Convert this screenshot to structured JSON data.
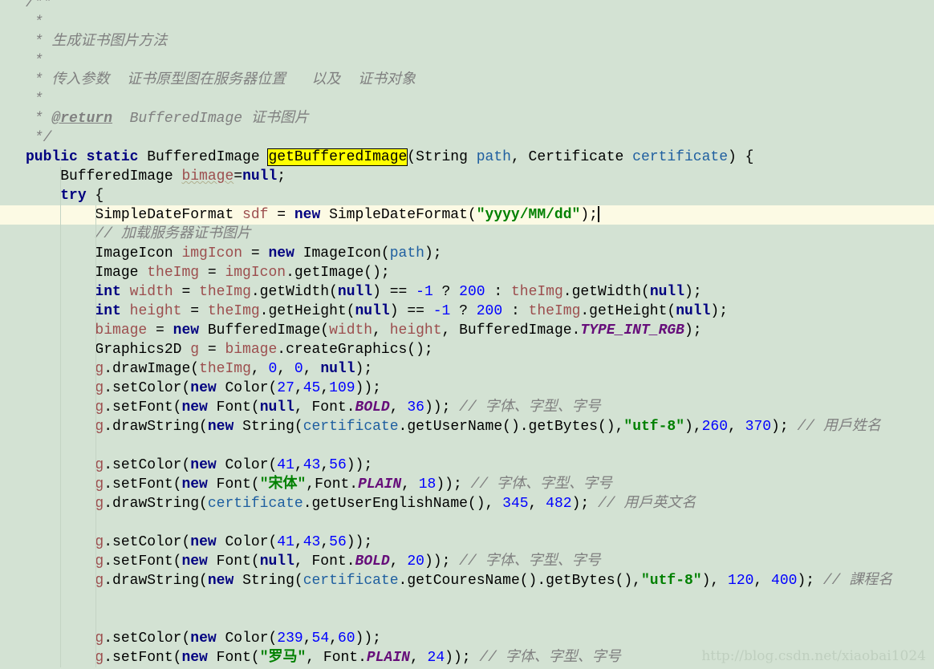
{
  "editor": {
    "current_line": 11,
    "lines": [
      [
        [
          "c",
          "/**"
        ]
      ],
      [
        [
          "c",
          " *"
        ]
      ],
      [
        [
          "c",
          " * 生成证书图片方法"
        ]
      ],
      [
        [
          "c",
          " *"
        ]
      ],
      [
        [
          "c",
          " * 传入参数  证书原型图在服务器位置   以及  证书对象"
        ]
      ],
      [
        [
          "c",
          " *"
        ]
      ],
      [
        [
          "c",
          " * "
        ],
        [
          "ct",
          "@return"
        ],
        [
          "c",
          "  BufferedImage 证书图片"
        ]
      ],
      [
        [
          "c",
          " */"
        ]
      ],
      [
        [
          "k",
          "public static "
        ],
        [
          "t",
          "BufferedImage "
        ],
        [
          "hl",
          "getBufferedImage"
        ],
        [
          "t",
          "(String "
        ],
        [
          "p",
          "path"
        ],
        [
          "t",
          ", Certificate "
        ],
        [
          "p",
          "certificate"
        ],
        [
          "t",
          ") {"
        ]
      ],
      [
        [
          "t",
          "    BufferedImage "
        ],
        [
          "vw",
          "bimage"
        ],
        [
          "t",
          "="
        ],
        [
          "k",
          "null"
        ],
        [
          "t",
          ";"
        ]
      ],
      [
        [
          "t",
          "    "
        ],
        [
          "k",
          "try"
        ],
        [
          "t",
          " {"
        ]
      ],
      [
        [
          "t",
          "        SimpleDateFormat "
        ],
        [
          "v",
          "sdf"
        ],
        [
          "t",
          " = "
        ],
        [
          "k",
          "new "
        ],
        [
          "t",
          "SimpleDateFormat("
        ],
        [
          "s",
          "\"yyyy/MM/dd\""
        ],
        [
          "t",
          ");"
        ],
        [
          "caret",
          ""
        ]
      ],
      [
        [
          "c",
          "        // 加载服务器证书图片"
        ]
      ],
      [
        [
          "t",
          "        ImageIcon "
        ],
        [
          "v",
          "imgIcon"
        ],
        [
          "t",
          " = "
        ],
        [
          "k",
          "new "
        ],
        [
          "t",
          "ImageIcon("
        ],
        [
          "p",
          "path"
        ],
        [
          "t",
          ");"
        ]
      ],
      [
        [
          "t",
          "        Image "
        ],
        [
          "v",
          "theImg"
        ],
        [
          "t",
          " = "
        ],
        [
          "v",
          "imgIcon"
        ],
        [
          "t",
          ".getImage();"
        ]
      ],
      [
        [
          "t",
          "        "
        ],
        [
          "k",
          "int "
        ],
        [
          "v",
          "width"
        ],
        [
          "t",
          " = "
        ],
        [
          "v",
          "theImg"
        ],
        [
          "t",
          ".getWidth("
        ],
        [
          "k",
          "null"
        ],
        [
          "t",
          ") == "
        ],
        [
          "n",
          "-1"
        ],
        [
          "t",
          " ? "
        ],
        [
          "n",
          "200"
        ],
        [
          "t",
          " : "
        ],
        [
          "v",
          "theImg"
        ],
        [
          "t",
          ".getWidth("
        ],
        [
          "k",
          "null"
        ],
        [
          "t",
          ");"
        ]
      ],
      [
        [
          "t",
          "        "
        ],
        [
          "k",
          "int "
        ],
        [
          "v",
          "height"
        ],
        [
          "t",
          " = "
        ],
        [
          "v",
          "theImg"
        ],
        [
          "t",
          ".getHeight("
        ],
        [
          "k",
          "null"
        ],
        [
          "t",
          ") == "
        ],
        [
          "n",
          "-1"
        ],
        [
          "t",
          " ? "
        ],
        [
          "n",
          "200"
        ],
        [
          "t",
          " : "
        ],
        [
          "v",
          "theImg"
        ],
        [
          "t",
          ".getHeight("
        ],
        [
          "k",
          "null"
        ],
        [
          "t",
          ");"
        ]
      ],
      [
        [
          "t",
          "        "
        ],
        [
          "v",
          "bimage"
        ],
        [
          "t",
          " = "
        ],
        [
          "k",
          "new "
        ],
        [
          "t",
          "BufferedImage("
        ],
        [
          "v",
          "width"
        ],
        [
          "t",
          ", "
        ],
        [
          "v",
          "height"
        ],
        [
          "t",
          ", BufferedImage."
        ],
        [
          "f",
          "TYPE_INT_RGB"
        ],
        [
          "t",
          ");"
        ]
      ],
      [
        [
          "t",
          "        Graphics2D "
        ],
        [
          "v",
          "g"
        ],
        [
          "t",
          " = "
        ],
        [
          "v",
          "bimage"
        ],
        [
          "t",
          ".createGraphics();"
        ]
      ],
      [
        [
          "t",
          "        "
        ],
        [
          "v",
          "g"
        ],
        [
          "t",
          ".drawImage("
        ],
        [
          "v",
          "theImg"
        ],
        [
          "t",
          ", "
        ],
        [
          "n",
          "0"
        ],
        [
          "t",
          ", "
        ],
        [
          "n",
          "0"
        ],
        [
          "t",
          ", "
        ],
        [
          "k",
          "null"
        ],
        [
          "t",
          ");"
        ]
      ],
      [
        [
          "t",
          "        "
        ],
        [
          "v",
          "g"
        ],
        [
          "t",
          ".setColor("
        ],
        [
          "k",
          "new "
        ],
        [
          "t",
          "Color("
        ],
        [
          "n",
          "27"
        ],
        [
          "t",
          ","
        ],
        [
          "n",
          "45"
        ],
        [
          "t",
          ","
        ],
        [
          "n",
          "109"
        ],
        [
          "t",
          "));"
        ]
      ],
      [
        [
          "t",
          "        "
        ],
        [
          "v",
          "g"
        ],
        [
          "t",
          ".setFont("
        ],
        [
          "k",
          "new "
        ],
        [
          "t",
          "Font("
        ],
        [
          "k",
          "null"
        ],
        [
          "t",
          ", Font."
        ],
        [
          "f",
          "BOLD"
        ],
        [
          "t",
          ", "
        ],
        [
          "n",
          "36"
        ],
        [
          "t",
          "));"
        ],
        [
          "c",
          " // 字体、字型、字号"
        ]
      ],
      [
        [
          "t",
          "        "
        ],
        [
          "v",
          "g"
        ],
        [
          "t",
          ".drawString("
        ],
        [
          "k",
          "new "
        ],
        [
          "t",
          "String("
        ],
        [
          "p",
          "certificate"
        ],
        [
          "t",
          ".getUserName().getBytes(),"
        ],
        [
          "s",
          "\"utf-8\""
        ],
        [
          "t",
          "),"
        ],
        [
          "n",
          "260"
        ],
        [
          "t",
          ", "
        ],
        [
          "n",
          "370"
        ],
        [
          "t",
          ");"
        ],
        [
          "c",
          " // 用戶姓名"
        ]
      ],
      [],
      [
        [
          "t",
          "        "
        ],
        [
          "v",
          "g"
        ],
        [
          "t",
          ".setColor("
        ],
        [
          "k",
          "new "
        ],
        [
          "t",
          "Color("
        ],
        [
          "n",
          "41"
        ],
        [
          "t",
          ","
        ],
        [
          "n",
          "43"
        ],
        [
          "t",
          ","
        ],
        [
          "n",
          "56"
        ],
        [
          "t",
          "));"
        ]
      ],
      [
        [
          "t",
          "        "
        ],
        [
          "v",
          "g"
        ],
        [
          "t",
          ".setFont("
        ],
        [
          "k",
          "new "
        ],
        [
          "t",
          "Font("
        ],
        [
          "s",
          "\"宋体\""
        ],
        [
          "t",
          ",Font."
        ],
        [
          "f",
          "PLAIN"
        ],
        [
          "t",
          ", "
        ],
        [
          "n",
          "18"
        ],
        [
          "t",
          "));"
        ],
        [
          "c",
          " // 字体、字型、字号"
        ]
      ],
      [
        [
          "t",
          "        "
        ],
        [
          "v",
          "g"
        ],
        [
          "t",
          ".drawString("
        ],
        [
          "p",
          "certificate"
        ],
        [
          "t",
          ".getUserEnglishName(), "
        ],
        [
          "n",
          "345"
        ],
        [
          "t",
          ", "
        ],
        [
          "n",
          "482"
        ],
        [
          "t",
          ");"
        ],
        [
          "c",
          " // 用戶英文名"
        ]
      ],
      [],
      [
        [
          "t",
          "        "
        ],
        [
          "v",
          "g"
        ],
        [
          "t",
          ".setColor("
        ],
        [
          "k",
          "new "
        ],
        [
          "t",
          "Color("
        ],
        [
          "n",
          "41"
        ],
        [
          "t",
          ","
        ],
        [
          "n",
          "43"
        ],
        [
          "t",
          ","
        ],
        [
          "n",
          "56"
        ],
        [
          "t",
          "));"
        ]
      ],
      [
        [
          "t",
          "        "
        ],
        [
          "v",
          "g"
        ],
        [
          "t",
          ".setFont("
        ],
        [
          "k",
          "new "
        ],
        [
          "t",
          "Font("
        ],
        [
          "k",
          "null"
        ],
        [
          "t",
          ", Font."
        ],
        [
          "f",
          "BOLD"
        ],
        [
          "t",
          ", "
        ],
        [
          "n",
          "20"
        ],
        [
          "t",
          "));"
        ],
        [
          "c",
          " // 字体、字型、字号"
        ]
      ],
      [
        [
          "t",
          "        "
        ],
        [
          "v",
          "g"
        ],
        [
          "t",
          ".drawString("
        ],
        [
          "k",
          "new "
        ],
        [
          "t",
          "String("
        ],
        [
          "p",
          "certificate"
        ],
        [
          "t",
          ".getCouresName().getBytes(),"
        ],
        [
          "s",
          "\"utf-8\""
        ],
        [
          "t",
          "), "
        ],
        [
          "n",
          "120"
        ],
        [
          "t",
          ", "
        ],
        [
          "n",
          "400"
        ],
        [
          "t",
          ");"
        ],
        [
          "c",
          " // 課程名"
        ]
      ],
      [],
      [],
      [
        [
          "t",
          "        "
        ],
        [
          "v",
          "g"
        ],
        [
          "t",
          ".setColor("
        ],
        [
          "k",
          "new "
        ],
        [
          "t",
          "Color("
        ],
        [
          "n",
          "239"
        ],
        [
          "t",
          ","
        ],
        [
          "n",
          "54"
        ],
        [
          "t",
          ","
        ],
        [
          "n",
          "60"
        ],
        [
          "t",
          "));"
        ]
      ],
      [
        [
          "t",
          "        "
        ],
        [
          "v",
          "g"
        ],
        [
          "t",
          ".setFont("
        ],
        [
          "k",
          "new "
        ],
        [
          "t",
          "Font("
        ],
        [
          "s",
          "\"罗马\""
        ],
        [
          "t",
          ", Font."
        ],
        [
          "f",
          "PLAIN"
        ],
        [
          "t",
          ", "
        ],
        [
          "n",
          "24"
        ],
        [
          "t",
          "));"
        ],
        [
          "c",
          " // 字体、字型、字号"
        ]
      ]
    ]
  },
  "watermark": "http://blog.csdn.net/xiaobai1024"
}
